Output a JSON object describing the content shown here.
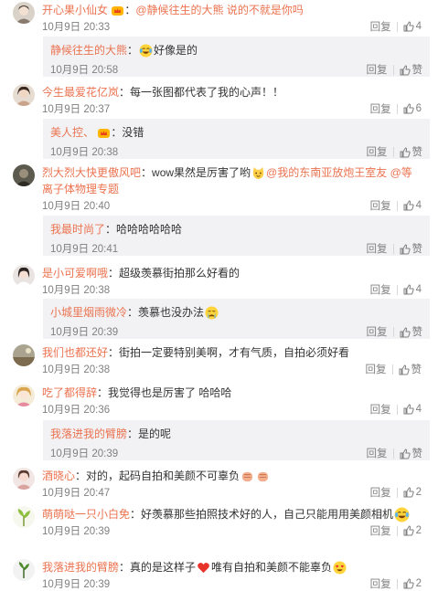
{
  "colors": {
    "username": "#eb7350",
    "meta": "#808080",
    "reply_bg": "#f2f2f5"
  },
  "labels": {
    "reply": "回复",
    "like": "赞"
  },
  "items": [
    {
      "user": "开心果小仙女",
      "badge": "crown-badge",
      "content": "@静候往生的大熊 说的不就是你吗",
      "time": "10月9日 20:33",
      "likes": "4"
    },
    {
      "user": "静候往生的大熊",
      "emoji": "laughing-tears-emoji",
      "content": "好像是的",
      "time": "10月9日 20:58",
      "like_label": "赞"
    },
    {
      "user": "今生最爱花亿岚",
      "content": "每一张图都代表了我的心声！！",
      "time": "10月9日 20:37",
      "likes": "6"
    },
    {
      "user": "美人控、",
      "badge": "crown-badge",
      "content": "没错",
      "time": "10月9日 20:38",
      "like_label": "赞"
    },
    {
      "user": "烈大烈大快更傲风吧",
      "content_line1": "wow果然是厉害了哟",
      "emoji": "cat-emoji",
      "mentions_line1": "@我的东南亚放炮王室友 @等",
      "content_line2": "离子体物理专题",
      "time": "10月9日 20:40",
      "likes": "4"
    },
    {
      "user": "我最时尚了",
      "content": "哈哈哈哈哈哈",
      "time": "10月9日 20:41",
      "like_label": "赞"
    },
    {
      "user": "是小可爱啊哦",
      "content": "超级羡慕街拍那么好看的",
      "time": "10月9日 20:38",
      "likes": "4"
    },
    {
      "user": "小城里烟雨微冷",
      "content": "羡慕也没办法",
      "emoji": "crying-emoji",
      "time": "10月9日 20:39",
      "like_label": "赞"
    },
    {
      "user": "我们也都还好",
      "content": "街拍一定要特别美啊，才有气质，自拍必须好看",
      "time": "10月9日 20:38",
      "like_label": "赞"
    },
    {
      "user": "吃了都得辞",
      "content": "我觉得也是厉害了 哈哈哈",
      "time": "10月9日 20:36",
      "likes": "4"
    },
    {
      "user": "我落进我的臂膀",
      "content": "是的呢",
      "time": "10月9日 20:39",
      "like_label": "赞"
    },
    {
      "user": "酒晓心",
      "content": "对的，起码自拍和美颜不可辜负",
      "emoji": "fist-emoji",
      "time": "10月9日 20:47",
      "likes": "2"
    },
    {
      "user": "萌萌哒一只小白免",
      "content": "好羡慕那些拍照技术好的人，自己只能用用美颜相机",
      "emoji": "laughing-tears-emoji",
      "time": "10月9日 20:39",
      "likes": "2"
    },
    {
      "user": "我落进我的臂膀",
      "content_a": "真的是这样子",
      "emoji_a": "heart-emoji",
      "content_b": "唯有自拍和美颜不能辜负",
      "emoji_b": "heart-eyes-emoji",
      "time": "10月9日 20:39",
      "likes": "2"
    }
  ]
}
